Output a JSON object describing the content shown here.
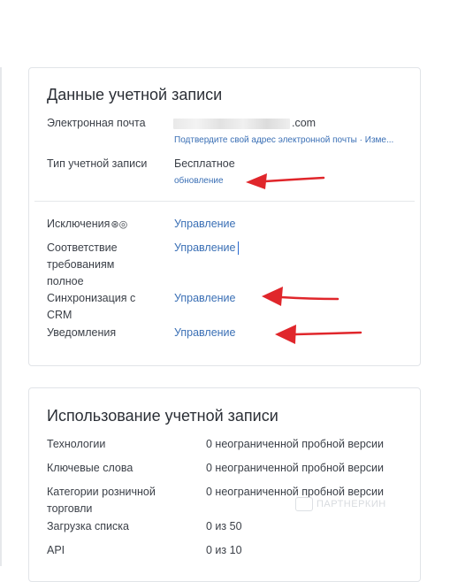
{
  "account": {
    "title": "Данные учетной записи",
    "email_label": "Электронная почта",
    "email_domain": ".com",
    "email_confirm_link": "Подтвердите свой адрес электронной почты · Изме...",
    "type_label": "Тип учетной записи",
    "type_value": "Бесплатное",
    "upgrade_link": "обновление",
    "rows": [
      {
        "label": "Исключения",
        "link": "Управление"
      },
      {
        "label": "Соответствие требованиям полное",
        "link": "Управление"
      },
      {
        "label": "Синхронизация с CRM",
        "link": "Управление"
      },
      {
        "label": "Уведомления",
        "link": "Управление"
      }
    ],
    "exclusion_icons": "⊛◎"
  },
  "usage": {
    "title": "Использование учетной записи",
    "rows": [
      {
        "label": "Технологии",
        "value": "0 неограниченной пробной версии"
      },
      {
        "label": "Ключевые слова",
        "value": "0 неограниченной пробной версии"
      },
      {
        "label": "Категории розничной торговли",
        "value": "0 неограниченной пробной версии"
      },
      {
        "label": "Загрузка списка",
        "value": "0 из 50"
      },
      {
        "label": "API",
        "value": "0 из 10"
      }
    ]
  },
  "watermark": {
    "text": "ПАРТНЕРКИН"
  },
  "colors": {
    "link": "#3a6fb5",
    "arrow": "#e0262b",
    "border": "#e1e4e8"
  }
}
